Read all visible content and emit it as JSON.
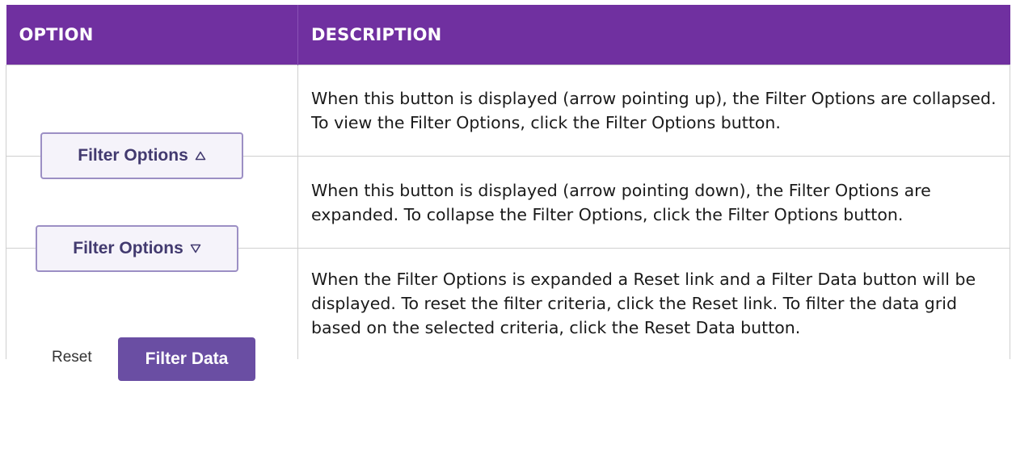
{
  "header": {
    "option": "OPTION",
    "description": "DESCRIPTION"
  },
  "rows": [
    {
      "button_label": "Filter Options",
      "arrow_icon": "triangle-up-icon",
      "description": "When this button is displayed (arrow pointing up), the Filter Options are collapsed. To view the Filter Options, click the Filter Options button."
    },
    {
      "button_label": "Filter Options",
      "arrow_icon": "triangle-down-icon",
      "description": "When this button is displayed (arrow pointing down), the Filter Options are expanded. To collapse the Filter Options, click the Filter Options button."
    },
    {
      "reset_label": "Reset",
      "filter_data_label": "Filter Data",
      "description": "When the Filter Options is expanded a Reset link and a Filter Data button will be displayed. To reset the filter criteria, click the Reset link. To filter the data grid based on the selected criteria, click the Reset Data button."
    }
  ],
  "colors": {
    "header_bg": "#7030a0",
    "button_border": "#9c8fc4",
    "button_text": "#423a6f",
    "filter_data_bg": "#6a4ea3"
  }
}
